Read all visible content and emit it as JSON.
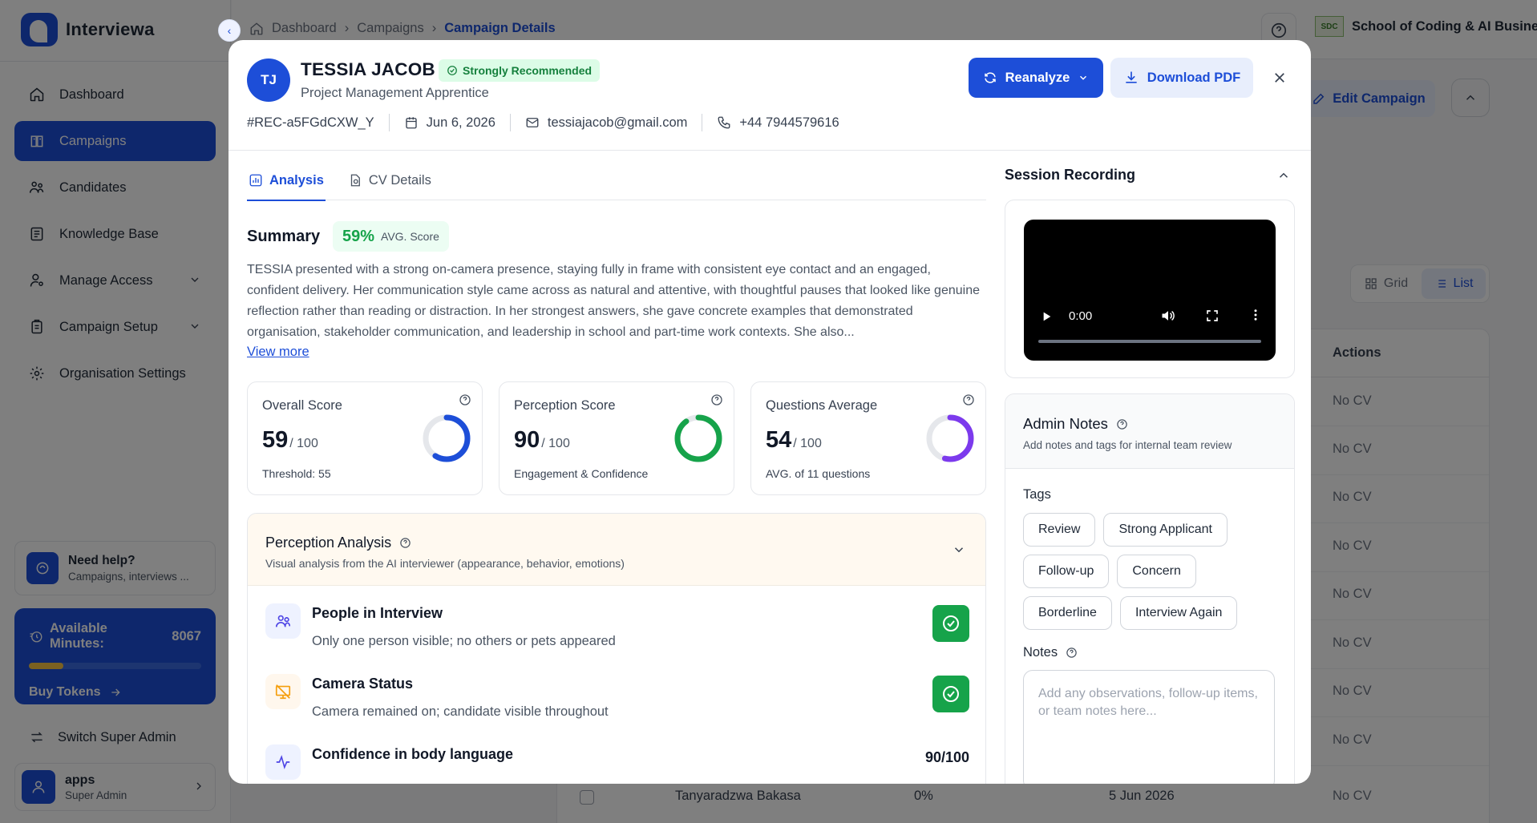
{
  "app": {
    "name": "Interviewa"
  },
  "sidebar": {
    "items": [
      {
        "label": "Dashboard",
        "icon": "home-icon"
      },
      {
        "label": "Campaigns",
        "icon": "book-icon",
        "active": true
      },
      {
        "label": "Candidates",
        "icon": "users-icon"
      },
      {
        "label": "Knowledge Base",
        "icon": "database-icon"
      },
      {
        "label": "Manage Access",
        "icon": "user-key-icon",
        "expandable": true
      },
      {
        "label": "Campaign Setup",
        "icon": "clipboard-icon",
        "expandable": true
      },
      {
        "label": "Organisation Settings",
        "icon": "gear-icon"
      }
    ],
    "help": {
      "title": "Need help?",
      "subtitle": "Campaigns, interviews ..."
    },
    "minutes": {
      "label": "Available Minutes:",
      "value": "8067",
      "fill_fraction": 0.2,
      "buy": "Buy Tokens"
    },
    "switch_label": "Switch Super Admin",
    "user": {
      "name": "apps",
      "role": "Super Admin"
    }
  },
  "topbar": {
    "breadcrumb": [
      "Dashboard",
      "Campaigns",
      "Campaign Details"
    ],
    "org_logo_text": "SDC",
    "org_name": "School of Coding & AI Business"
  },
  "page": {
    "edit_campaign": "Edit Campaign",
    "view_grid": "Grid",
    "view_list": "List",
    "actions_header": "Actions",
    "row_action": "No CV",
    "last_row": {
      "name": "Tanyaradzwa Bakasa",
      "score": "0%",
      "date": "5 Jun 2026",
      "action": "No CV"
    }
  },
  "modal": {
    "initials": "TJ",
    "name": "TESSIA JACOB",
    "badge": "Strongly Recommended",
    "role": "Project Management Apprentice",
    "ref": "#REC-a5FGdCXW_Y",
    "date": "Jun 6, 2026",
    "email": "tessiajacob@gmail.com",
    "phone": "+44 7944579616",
    "reanalyze": "Reanalyze",
    "download": "Download PDF",
    "tabs": [
      {
        "label": "Analysis",
        "active": true
      },
      {
        "label": "CV Details"
      }
    ],
    "summary": {
      "title": "Summary",
      "score": "59%",
      "score_label": "AVG. Score",
      "text": "TESSIA presented with a strong on-camera presence, staying fully in frame with consistent eye contact and an engaged, confident delivery. Her communication style came across as natural and attentive, with thoughtful pauses that looked like genuine reflection rather than reading or distraction. In her strongest answers, she gave concrete examples that demonstrated organisation, stakeholder communication, and leadership in school and part-time work contexts. She also...",
      "view_more": "View more"
    },
    "score_cards": [
      {
        "title": "Overall Score",
        "value": "59",
        "of": "/ 100",
        "sub": "Threshold: 55",
        "percent": 59,
        "color": "#1d4ed8"
      },
      {
        "title": "Perception Score",
        "value": "90",
        "of": "/ 100",
        "sub": "Engagement & Confidence",
        "percent": 90,
        "color": "#16a34a"
      },
      {
        "title": "Questions Average",
        "value": "54",
        "of": "/ 100",
        "sub": "AVG. of 11 questions",
        "percent": 54,
        "color": "#7c3aed"
      }
    ],
    "perception": {
      "title": "Perception Analysis",
      "subtitle": "Visual analysis from the AI interviewer (appearance, behavior, emotions)",
      "items": [
        {
          "title": "People in Interview",
          "desc": "Only one person visible; no others or pets appeared",
          "icon": "users-icon",
          "status": "pass"
        },
        {
          "title": "Camera Status",
          "desc": "Camera remained on; candidate visible throughout",
          "icon": "camera-off-icon",
          "status": "pass"
        },
        {
          "title": "Confidence in body language",
          "desc": "",
          "icon": "activity-icon",
          "score": "90/100"
        }
      ]
    },
    "recording": {
      "title": "Session Recording",
      "time": "0:00"
    },
    "notes": {
      "title": "Admin Notes",
      "subtitle": "Add notes and tags for internal team review",
      "tags_label": "Tags",
      "tags": [
        "Review",
        "Strong Applicant",
        "Follow-up",
        "Concern",
        "Borderline",
        "Interview Again"
      ],
      "notes_label": "Notes",
      "placeholder": "Add any observations, follow-up items, or team notes here..."
    }
  },
  "colors": {
    "accent": "#1d4ed8",
    "success": "#16a34a",
    "warning": "#f6c343",
    "purple": "#7c3aed"
  }
}
